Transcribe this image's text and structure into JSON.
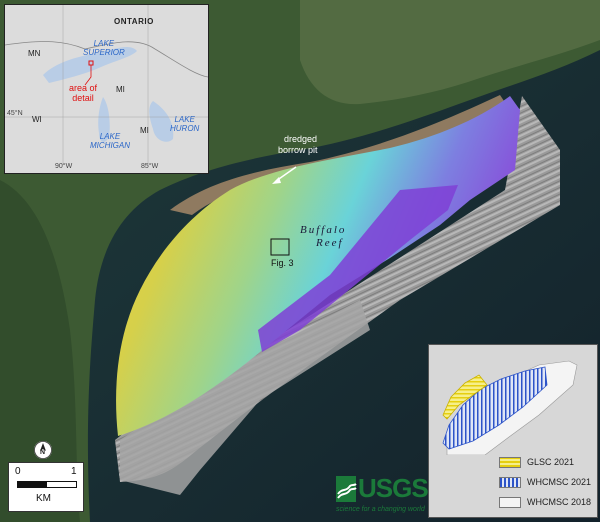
{
  "map": {
    "annotations": {
      "borrow_pit_line1": "dredged",
      "borrow_pit_line2": "borrow pit",
      "reef_line1": "Buffalo",
      "reef_line2": "Reef",
      "figure_box": "Fig. 3"
    }
  },
  "inset": {
    "country": "ONTARIO",
    "states": [
      "MN",
      "WI",
      "MI",
      "MI"
    ],
    "lake_superior_1": "LAKE",
    "lake_superior_2": "SUPERIOR",
    "lake_michigan_1": "LAKE",
    "lake_michigan_2": "MICHIGAN",
    "lake_huron_1": "LAKE",
    "lake_huron_2": "HURON",
    "area_label_1": "area of",
    "area_label_2": "detail",
    "lat_45": "45°N",
    "lon_90": "90°W",
    "lon_85": "85°W"
  },
  "legend": {
    "items": [
      {
        "label": "GLSC 2021",
        "color": "#f2e233",
        "pattern": "horizontal-hatch"
      },
      {
        "label": "WHCMSC 2021",
        "color": "#2c53c8",
        "pattern": "vertical-hatch"
      },
      {
        "label": "WHCMSC 2018",
        "color": "#f4f4f4",
        "pattern": "solid"
      }
    ]
  },
  "scale_bar": {
    "start": "0",
    "end": "1",
    "unit": "KM"
  },
  "north_arrow": {
    "letter": "N"
  },
  "logo": {
    "name": "USGS",
    "tagline": "science for a changing world"
  }
}
